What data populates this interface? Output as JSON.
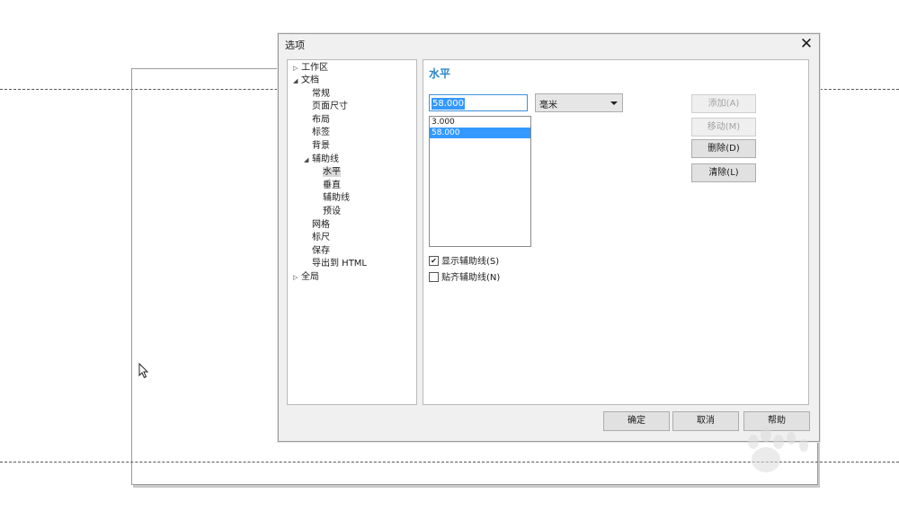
{
  "dialog": {
    "title": "选项",
    "close_glyph": "✕"
  },
  "tree": {
    "items": [
      {
        "label": "工作区",
        "arrow": "▷"
      },
      {
        "label": "文档",
        "arrow": "◢"
      },
      {
        "label": "常规",
        "arrow": ""
      },
      {
        "label": "页面尺寸",
        "arrow": ""
      },
      {
        "label": "布局",
        "arrow": ""
      },
      {
        "label": "标签",
        "arrow": ""
      },
      {
        "label": "背景",
        "arrow": ""
      },
      {
        "label": "辅助线",
        "arrow": "◢"
      },
      {
        "label": "水平",
        "arrow": ""
      },
      {
        "label": "垂直",
        "arrow": ""
      },
      {
        "label": "辅助线",
        "arrow": ""
      },
      {
        "label": "预设",
        "arrow": ""
      },
      {
        "label": "网格",
        "arrow": ""
      },
      {
        "label": "标尺",
        "arrow": ""
      },
      {
        "label": "保存",
        "arrow": ""
      },
      {
        "label": "导出到 HTML",
        "arrow": ""
      },
      {
        "label": "全局",
        "arrow": "▷"
      }
    ],
    "selected": "水平"
  },
  "panel": {
    "title": "水平",
    "value_input": "58.000",
    "unit": "毫米",
    "guides": [
      "3.000",
      "58.000"
    ],
    "selected_guide": "58.000",
    "buttons": {
      "add": "添加(A)",
      "move": "移动(M)",
      "delete": "删除(D)",
      "clear": "清除(L)"
    },
    "show_guides": {
      "label": "显示辅助线(S)",
      "checked": true
    },
    "snap_guides": {
      "label": "贴齐辅助线(N)",
      "checked": false
    }
  },
  "footer": {
    "ok": "确定",
    "cancel": "取消",
    "help": "帮助"
  },
  "icons": {
    "cursor": "mouse-pointer-icon",
    "close": "close-icon",
    "collapsed": "triangle-right-icon",
    "expanded": "triangle-down-icon",
    "dropdown": "chevron-down-icon",
    "check": "checkmark-icon"
  },
  "colors": {
    "accent": "#2a86c8",
    "selection": "#3399ff",
    "dialog_bg": "#f0f0f0"
  }
}
